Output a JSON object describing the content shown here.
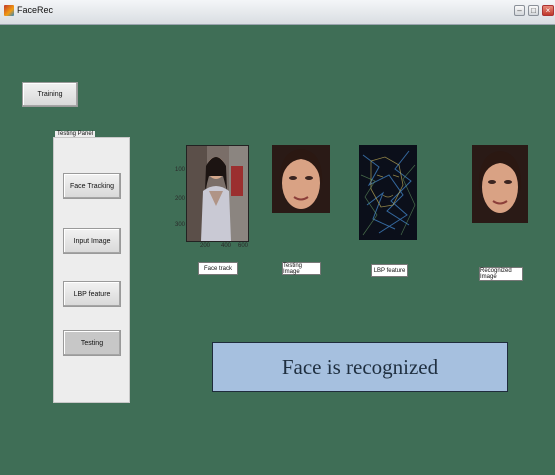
{
  "window": {
    "title": "FaceRec",
    "minimize_glyph": "–",
    "maximize_glyph": "□",
    "close_glyph": "×"
  },
  "controls": {
    "training_label": "Training"
  },
  "testing_panel": {
    "title": "Testing Panel",
    "buttons": [
      "Face Tracking",
      "Input Image",
      "LBP feature",
      "Testing"
    ]
  },
  "axes": {
    "y_ticks": [
      "100",
      "200",
      "300"
    ],
    "x_ticks": [
      "200",
      "400",
      "600"
    ]
  },
  "image_labels": {
    "face_track": "Face track",
    "testing_image": "Testing Image",
    "lbp_feature": "LBP feature",
    "recognized_image": "Recognized Image"
  },
  "result": {
    "message": "Face is recognized"
  }
}
